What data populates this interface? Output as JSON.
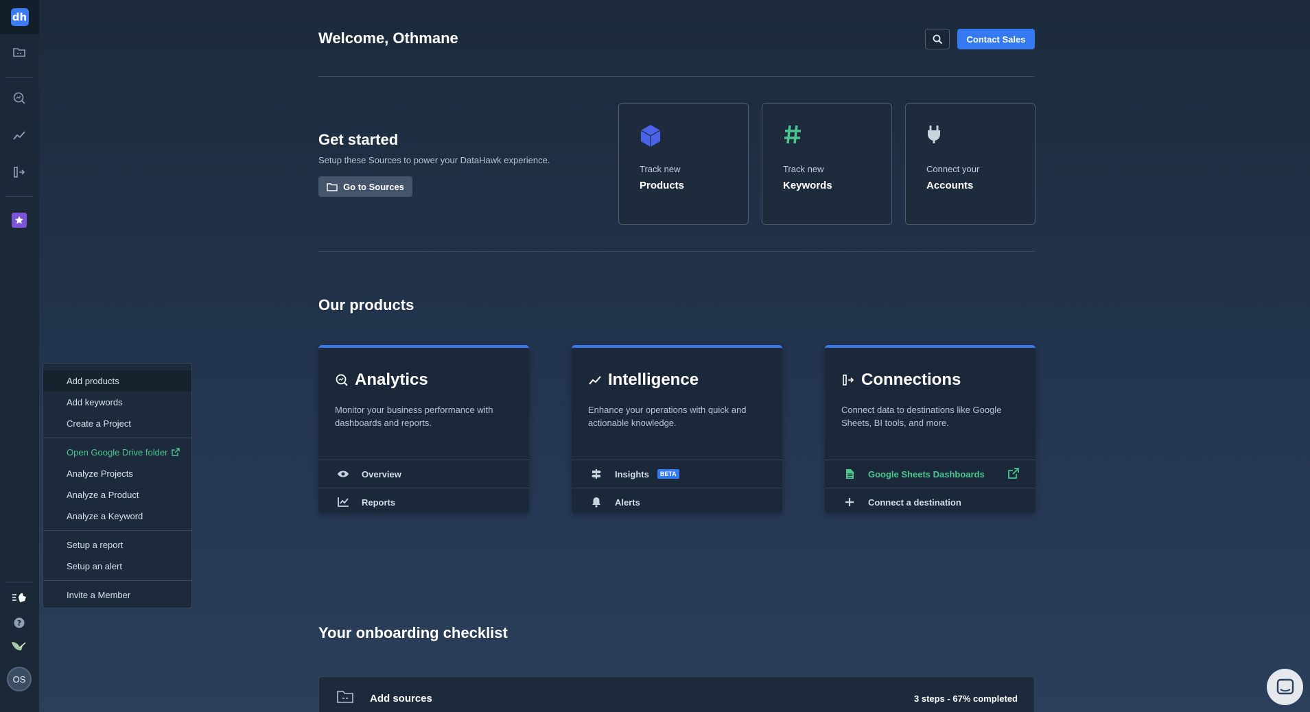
{
  "sidebar": {
    "logo_text": "dh",
    "avatar_initials": "OS",
    "icons": [
      "folder-icon",
      "analytics-icon",
      "intelligence-icon",
      "connections-icon",
      "star-icon",
      "whats-new-icon",
      "help-icon",
      "bird-icon"
    ]
  },
  "menu": {
    "items": [
      "Add products",
      "Add keywords",
      "Create a Project",
      "Open Google Drive folder",
      "Analyze Projects",
      "Analyze a Product",
      "Analyze a Keyword",
      "Setup a report",
      "Setup an alert",
      "Invite a Member"
    ]
  },
  "header": {
    "welcome": "Welcome, Othmane",
    "contact_sales": "Contact Sales"
  },
  "get_started": {
    "title": "Get started",
    "subtitle": "Setup these Sources to power your DataHawk experience.",
    "button": "Go to Sources",
    "cards": [
      {
        "small": "Track new",
        "big": "Products",
        "icon": "cube-icon"
      },
      {
        "small": "Track new",
        "big": "Keywords",
        "icon": "hash-icon"
      },
      {
        "small": "Connect your",
        "big": "Accounts",
        "icon": "plug-icon"
      }
    ]
  },
  "products": {
    "title": "Our products",
    "cards": [
      {
        "name": "Analytics",
        "desc": "Monitor your business performance with dashboards and reports.",
        "rows": [
          "Overview",
          "Reports"
        ]
      },
      {
        "name": "Intelligence",
        "desc": "Enhance your operations with quick and actionable knowledge.",
        "rows": [
          "Insights",
          "Alerts"
        ],
        "badge": "BETA"
      },
      {
        "name": "Connections",
        "desc": "Connect data to destinations like Google Sheets, BI tools, and more.",
        "rows": [
          "Google Sheets Dashboards",
          "Connect a destination"
        ]
      }
    ]
  },
  "checklist": {
    "title": "Your onboarding checklist",
    "item": "Add sources",
    "progress": "3 steps - 67% completed"
  },
  "colors": {
    "accent": "#3479f0",
    "green": "#4cc58f",
    "cube": "#4b63e8",
    "hash": "#4cc58f",
    "star": "#7a56d6"
  }
}
